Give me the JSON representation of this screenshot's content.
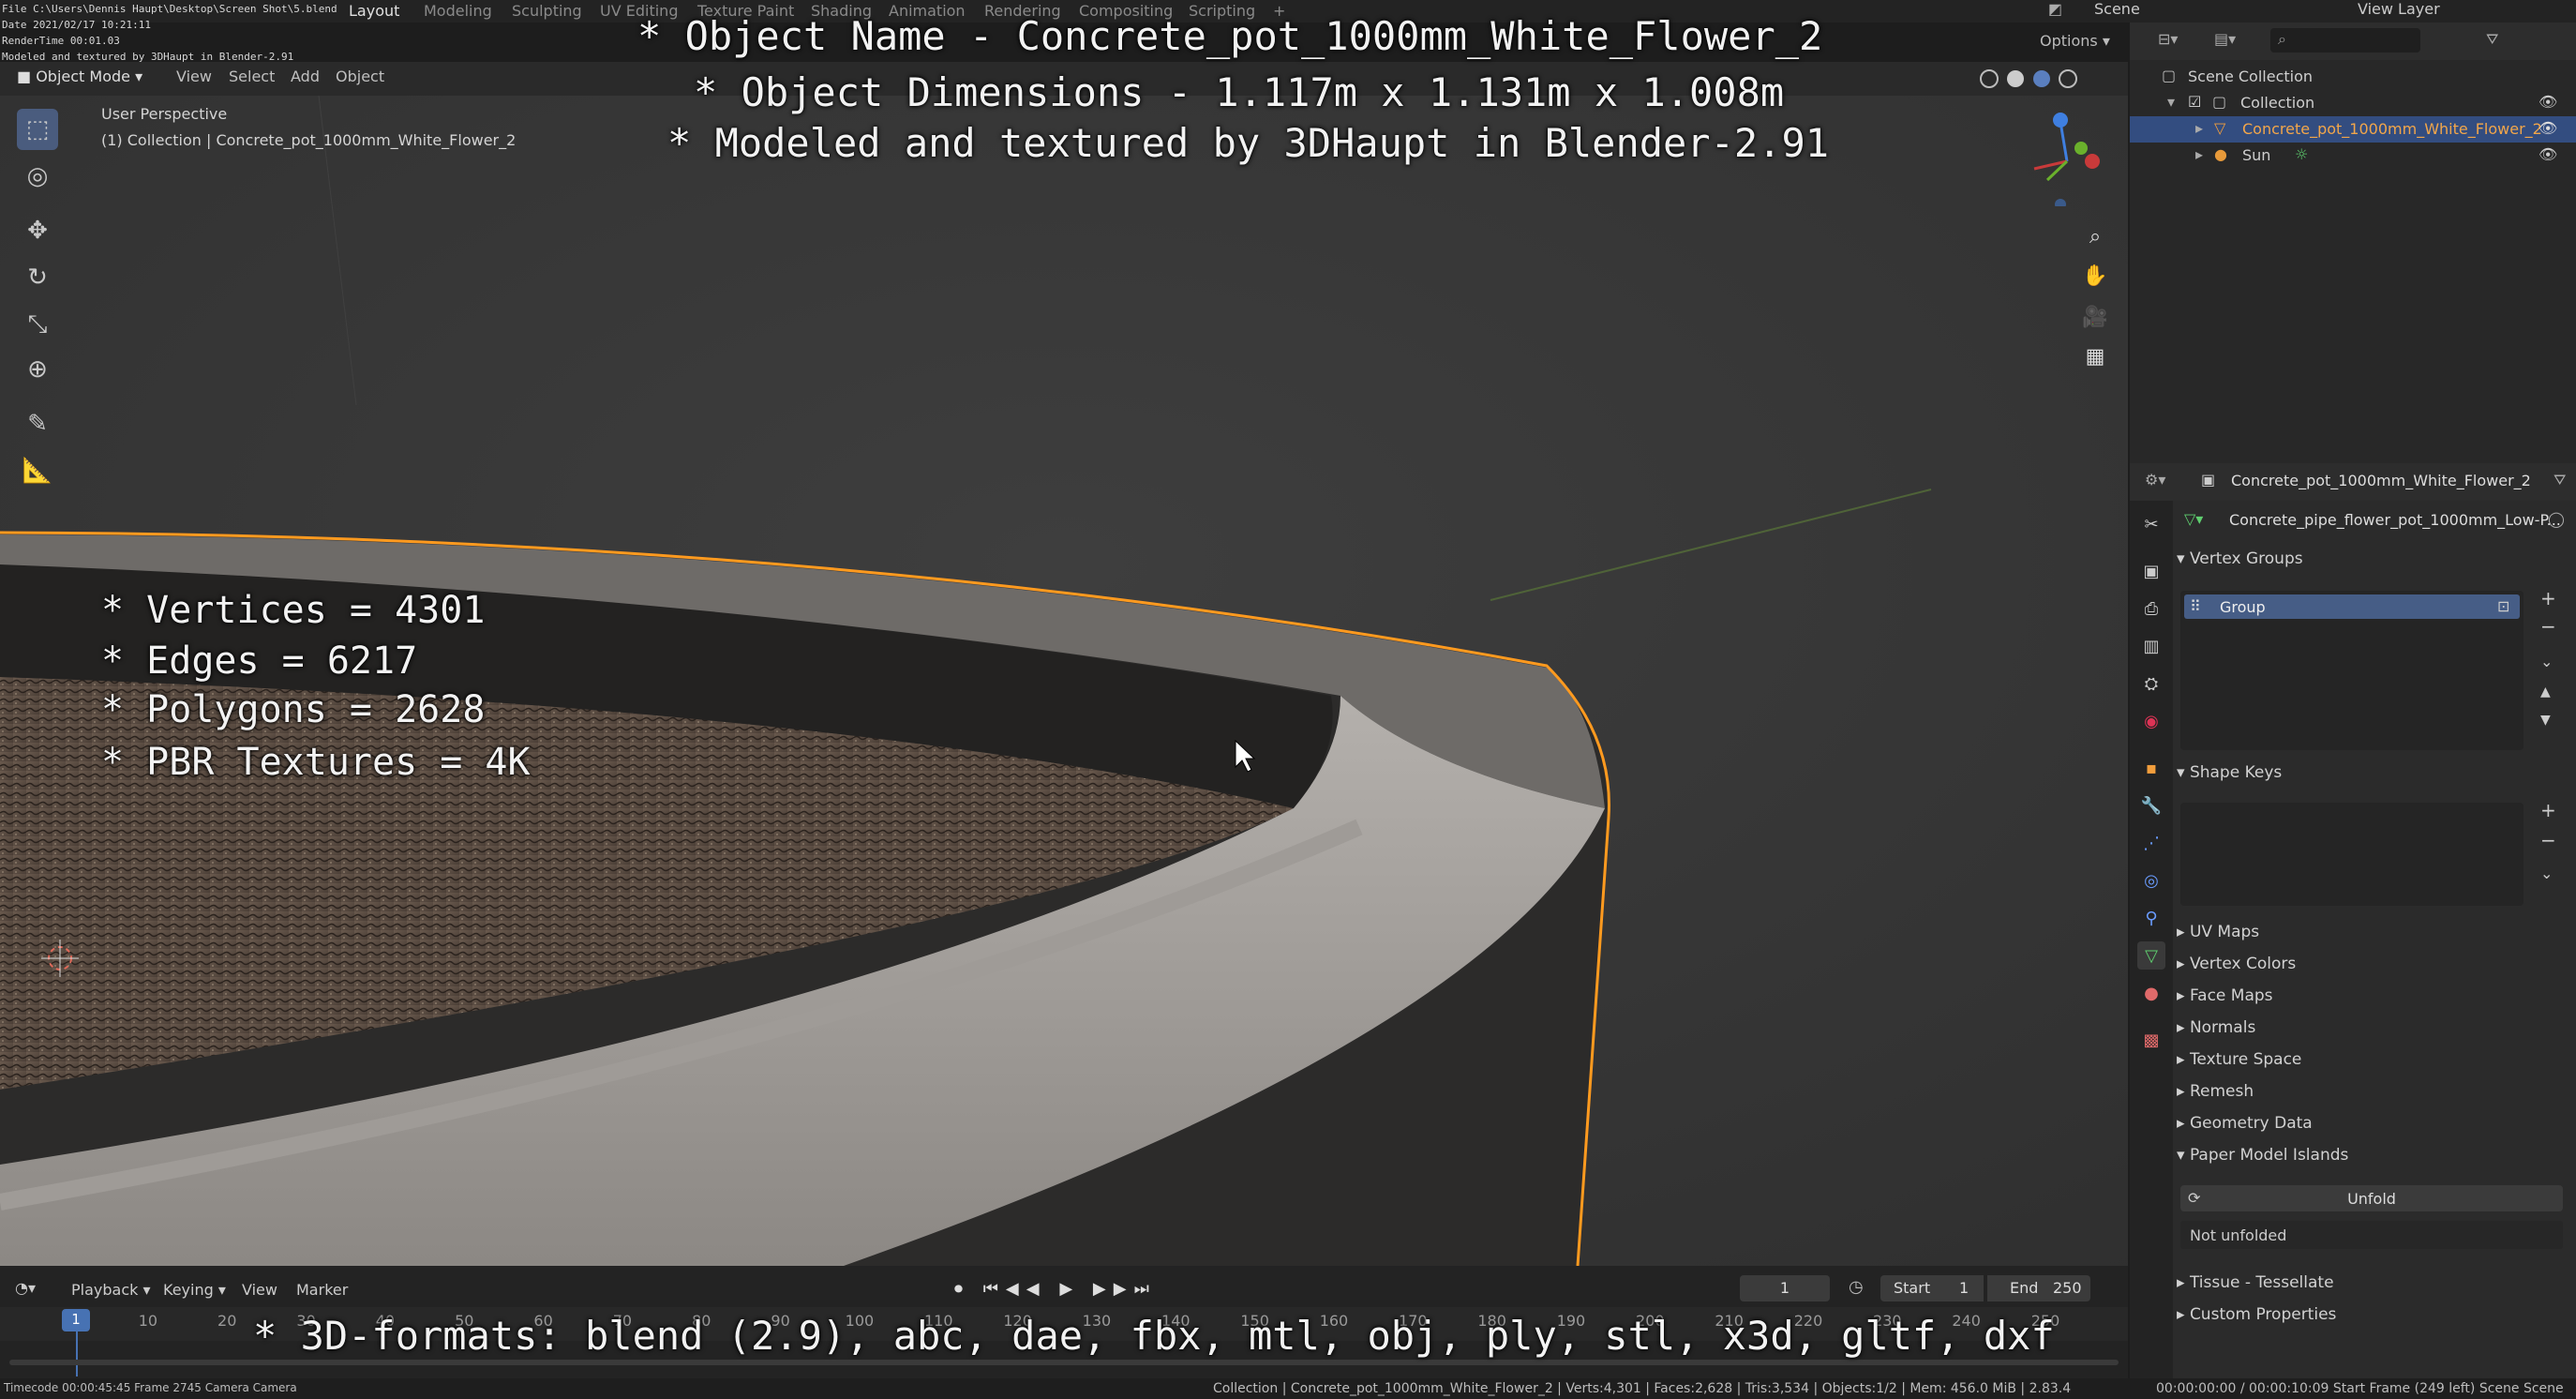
{
  "topbar": {
    "tabs": [
      "Layout",
      "Modeling",
      "Sculpting",
      "UV Editing",
      "Texture Paint",
      "Shading",
      "Animation",
      "Rendering",
      "Compositing",
      "Scripting",
      "+"
    ],
    "scene_label": "Scene",
    "view_layer_label": "View Layer"
  },
  "file_info": {
    "line1": "File C:\\Users\\Dennis Haupt\\Desktop\\Screen Shot\\5.blend",
    "line2": "Date 2021/02/17 10:21:11",
    "line3": "RenderTime 00:01.03",
    "line4": "Modeled and textured by 3DHaupt in Blender-2.91"
  },
  "viewport_header": {
    "mode": "Object Mode",
    "menus": [
      "View",
      "Select",
      "Add",
      "Object"
    ],
    "options": "Options"
  },
  "viewport": {
    "perspective": "User Perspective",
    "collection_info": "(1) Collection | Concrete_pot_1000mm_White_Flower_2"
  },
  "watermark": {
    "name": "* Object Name - Concrete_pot_1000mm_White_Flower_2",
    "dims": "* Object Dimensions -  1.117m x 1.131m x 1.008m",
    "modeled": "* Modeled and textured by 3DHaupt in Blender-2.91",
    "vertices": "* Vertices = 4301",
    "edges": "* Edges = 6217",
    "polygons": "* Polygons = 2628",
    "pbr": "* PBR Textures = 4K",
    "formats": "* 3D-formats: blend (2.9), abc, dae, fbx, mtl, obj, ply, stl, x3d, gltf, dxf"
  },
  "outliner": {
    "scene_collection": "Scene Collection",
    "collection": "Collection",
    "object": "Concrete_pot_1000mm_White_Flower_2",
    "sun": "Sun"
  },
  "properties": {
    "object_name": "Concrete_pot_1000mm_White_Flower_2",
    "mesh_name": "Concrete_pipe_flower_pot_1000mm_Low-P...",
    "vertex_groups": "Vertex Groups",
    "group": "Group",
    "shape_keys": "Shape Keys",
    "sections": [
      "UV Maps",
      "Vertex Colors",
      "Face Maps",
      "Normals",
      "Texture Space",
      "Remesh",
      "Geometry Data",
      "Paper Model Islands"
    ],
    "unfold": "Unfold",
    "not_unfolded": "Not unfolded",
    "sections2": [
      "Tissue - Tessellate",
      "Custom Properties"
    ]
  },
  "timeline": {
    "menus": [
      "Playback",
      "Keying",
      "View",
      "Marker"
    ],
    "current_frame": "1",
    "start_label": "Start",
    "start_value": "1",
    "end_label": "End",
    "end_value": "250",
    "ticks": [
      "1",
      "10",
      "20",
      "30",
      "40",
      "50",
      "60",
      "70",
      "80",
      "90",
      "100",
      "110",
      "120",
      "130",
      "140",
      "150",
      "160",
      "170",
      "180",
      "190",
      "200",
      "210",
      "220",
      "230",
      "240",
      "250"
    ]
  },
  "statusbar": {
    "left": "Timecode 00:00:45:45    Frame 2745    Camera Camera",
    "center": "Collection | Concrete_pot_1000mm_White_Flower_2 | Verts:4,301 | Faces:2,628 | Tris:3,534 | Objects:1/2 | Mem: 456.0 MiB | 2.83.4",
    "right": "00:00:00:00 / 00:00:10:09     Start Frame (249 left)     Scene Scene"
  },
  "colors": {
    "selection_orange": "#ff9a1f",
    "header_bg": "#2a2a2a",
    "panel_bg": "#2b2b2b",
    "active_blue": "#334d80"
  }
}
